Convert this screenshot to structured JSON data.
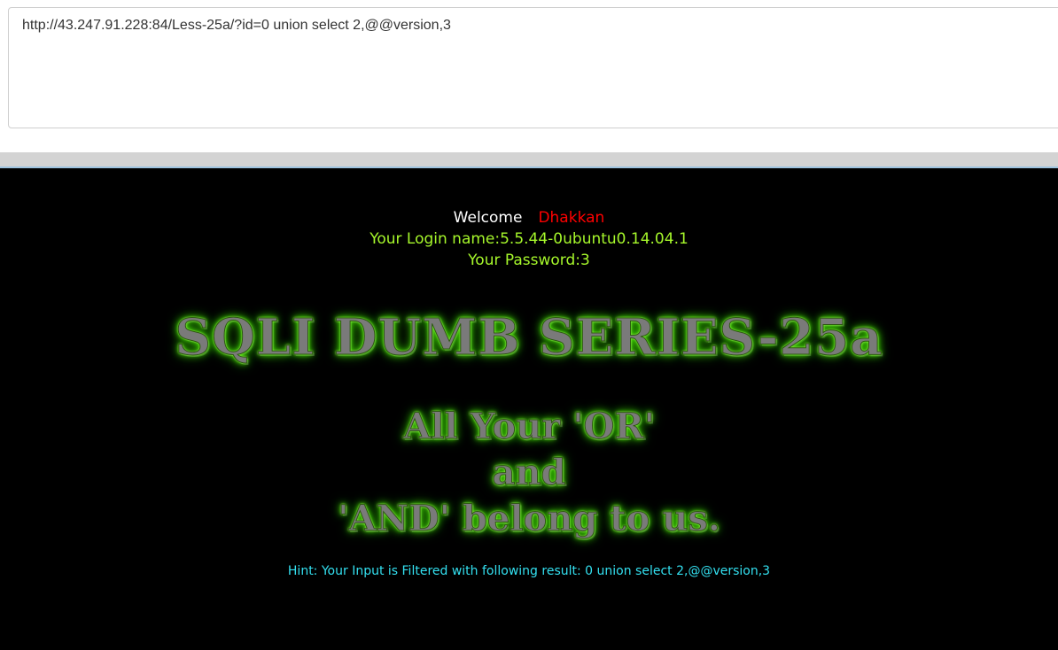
{
  "address_bar": {
    "url": "http://43.247.91.228:84/Less-25a/?id=0 union select 2,@@version,3"
  },
  "welcome": {
    "greeting": "Welcome",
    "user": "Dhakkan",
    "login_name": "Your Login name:5.5.44-0ubuntu0.14.04.1",
    "password": "Your Password:3"
  },
  "banner": {
    "title": "SQLI DUMB SERIES-25a",
    "slogan_line1": "All Your 'OR'",
    "slogan_line2": "and",
    "slogan_line3": "'AND' belong to us."
  },
  "hint": {
    "text": "Hint: Your Input is Filtered with following result: 0 union select 2,@@version,3"
  },
  "colors": {
    "page_background": "#000000",
    "welcome_text": "#ffffff",
    "user_name": "#ff0000",
    "info_text": "#a6f72b",
    "hint_text": "#33e0f0",
    "banner_glow": "#3bd400"
  }
}
